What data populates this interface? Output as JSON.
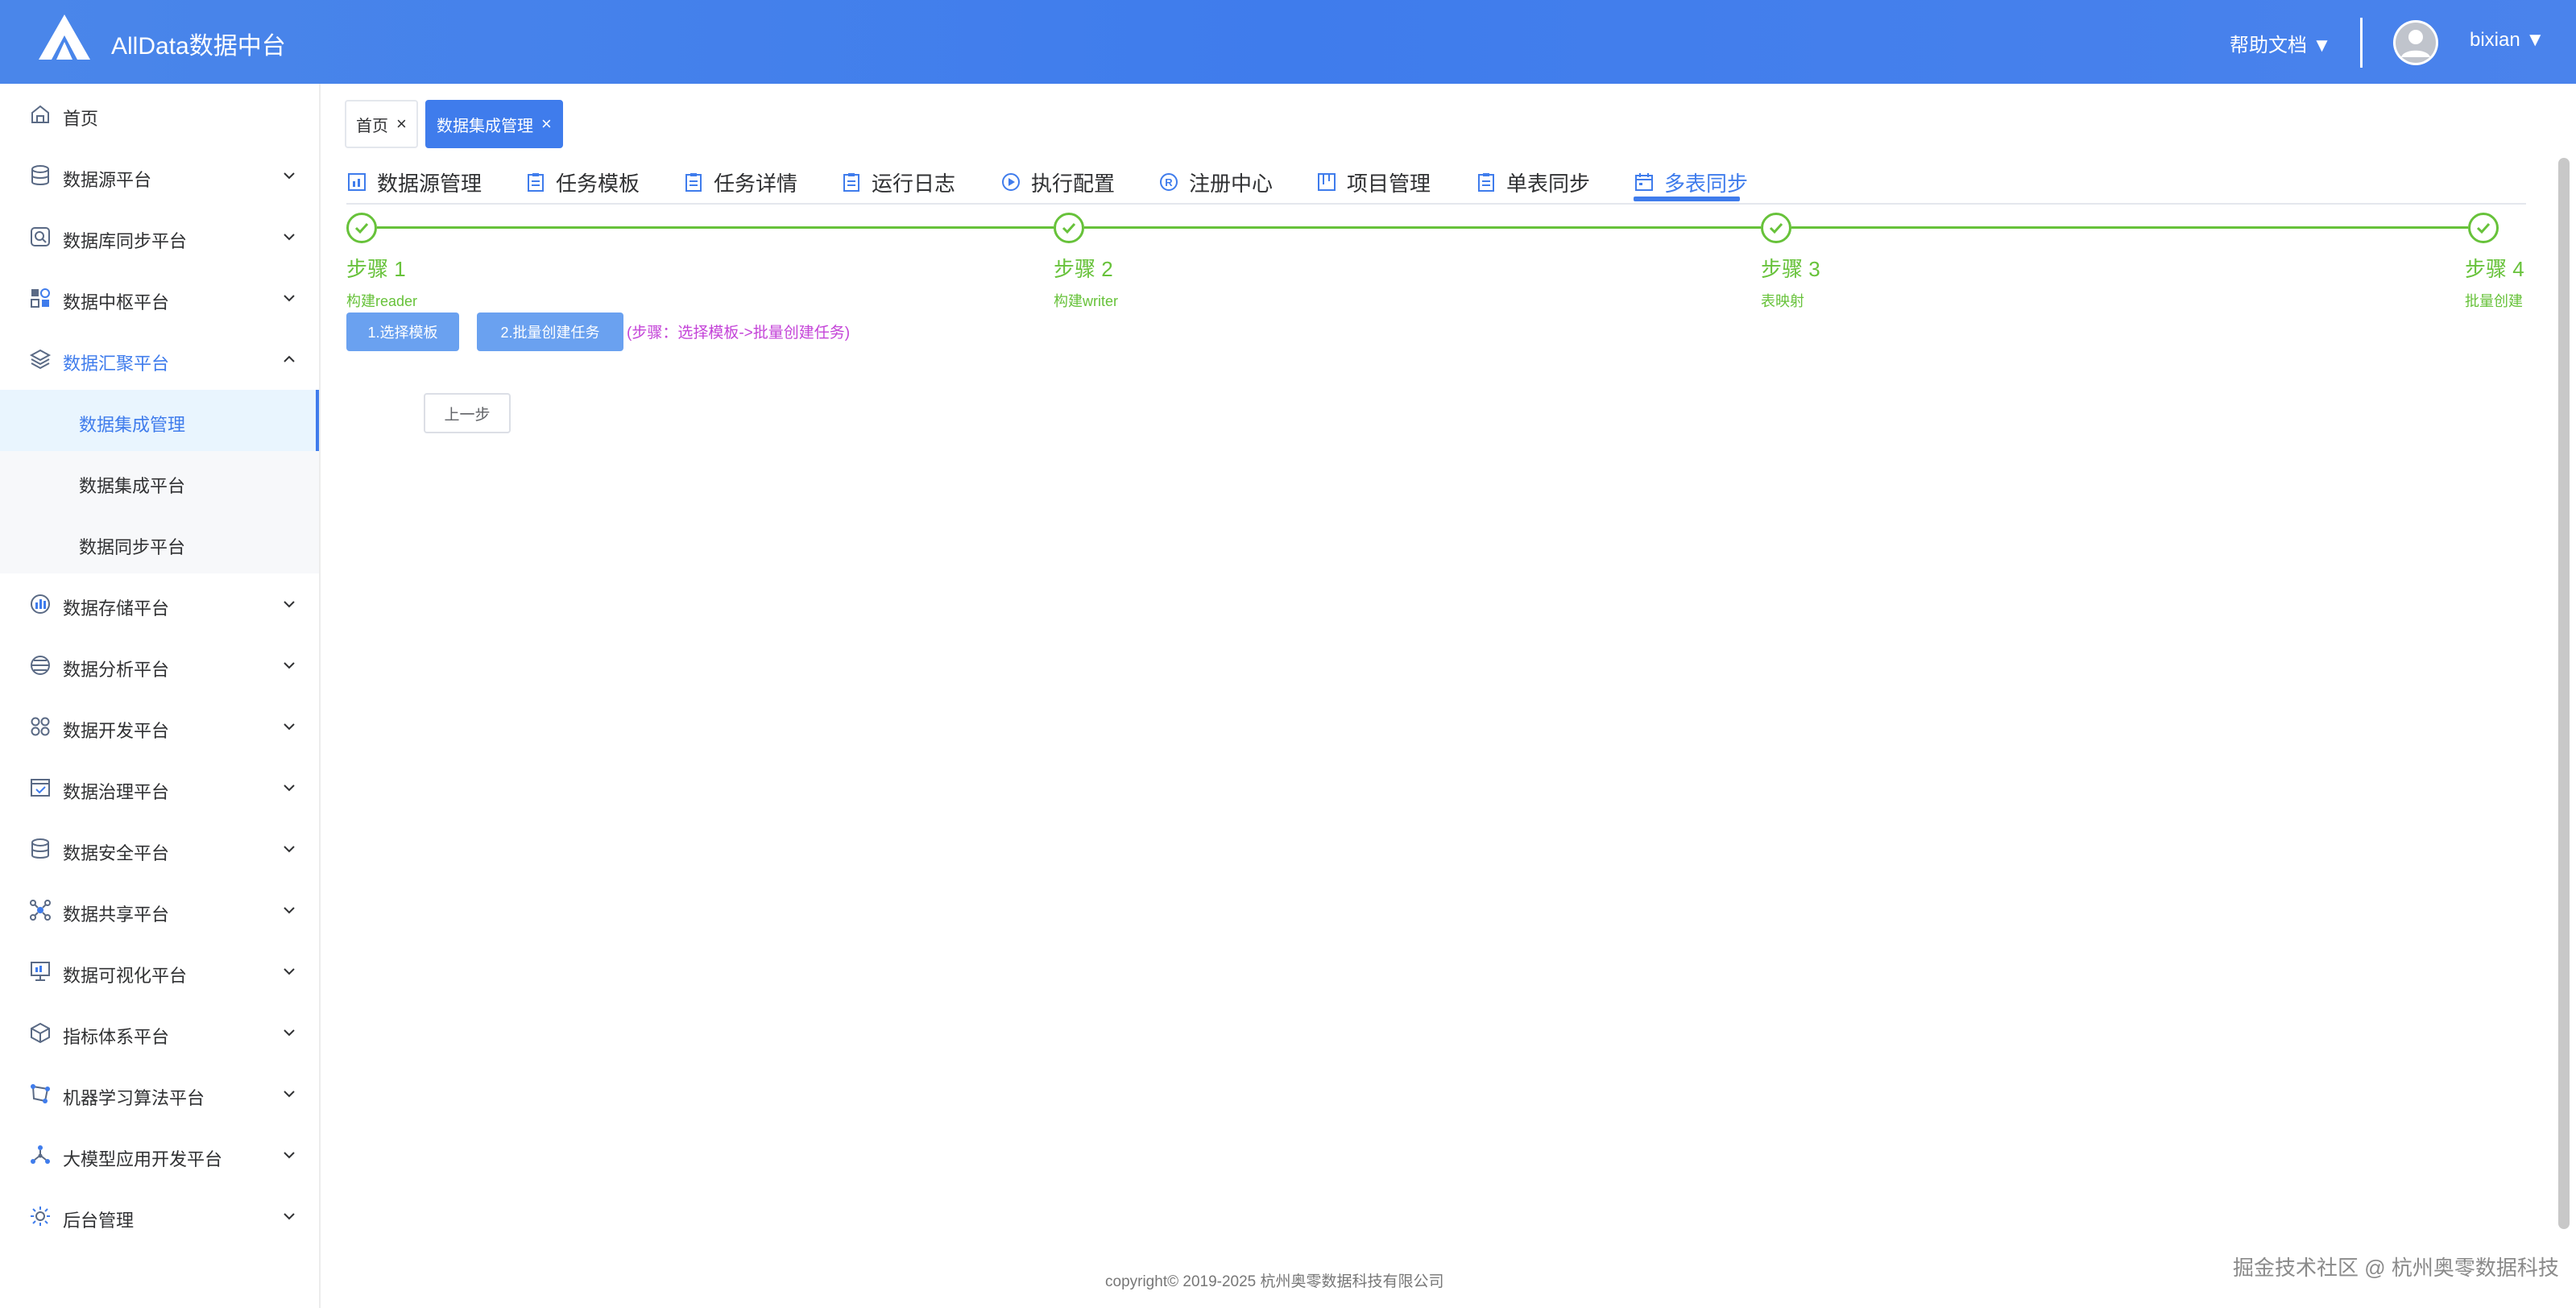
{
  "header": {
    "app_title": "AllData数据中台",
    "help_label": "帮助文档 ▼",
    "user_name": "bixian ▼"
  },
  "sidebar": {
    "items": [
      {
        "label": "首页",
        "icon": "home-icon"
      },
      {
        "label": "数据源平台",
        "icon": "database-icon"
      },
      {
        "label": "数据库同步平台",
        "icon": "db-sync-icon"
      },
      {
        "label": "数据中枢平台",
        "icon": "hub-icon"
      },
      {
        "label": "数据汇聚平台",
        "icon": "layers-icon"
      },
      {
        "label": "数据存储平台",
        "icon": "storage-icon"
      },
      {
        "label": "数据分析平台",
        "icon": "analysis-icon"
      },
      {
        "label": "数据开发平台",
        "icon": "dev-icon"
      },
      {
        "label": "数据治理平台",
        "icon": "governance-icon"
      },
      {
        "label": "数据安全平台",
        "icon": "security-icon"
      },
      {
        "label": "数据共享平台",
        "icon": "share-icon"
      },
      {
        "label": "数据可视化平台",
        "icon": "visual-icon"
      },
      {
        "label": "指标体系平台",
        "icon": "metric-icon"
      },
      {
        "label": "机器学习算法平台",
        "icon": "ml-icon"
      },
      {
        "label": "大模型应用开发平台",
        "icon": "llm-icon"
      },
      {
        "label": "后台管理",
        "icon": "admin-icon"
      }
    ],
    "submenu": [
      {
        "label": "数据集成管理"
      },
      {
        "label": "数据集成平台"
      },
      {
        "label": "数据同步平台"
      }
    ]
  },
  "tags": [
    {
      "label": "首页",
      "close": "×"
    },
    {
      "label": "数据集成管理",
      "close": "×"
    }
  ],
  "tabs": [
    {
      "label": "数据源管理"
    },
    {
      "label": "任务模板"
    },
    {
      "label": "任务详情"
    },
    {
      "label": "运行日志"
    },
    {
      "label": "执行配置"
    },
    {
      "label": "注册中心"
    },
    {
      "label": "项目管理"
    },
    {
      "label": "单表同步"
    },
    {
      "label": "多表同步"
    }
  ],
  "steps": [
    {
      "title": "步骤 1",
      "desc": "构建reader"
    },
    {
      "title": "步骤 2",
      "desc": "构建writer"
    },
    {
      "title": "步骤 3",
      "desc": "表映射"
    },
    {
      "title": "步骤 4",
      "desc": "批量创建"
    }
  ],
  "actions": {
    "select_template": "1.选择模板",
    "batch_create": "2.批量创建任务",
    "hint": "(步骤：选择模板->批量创建任务)",
    "prev_step": "上一步"
  },
  "footer": {
    "copyright": "copyright© 2019-2025 杭州奥零数据科技有限公司",
    "watermark": "掘金技术社区 @ 杭州奥零数据科技"
  },
  "colors": {
    "primary": "#3f7cec",
    "success": "#67c23a",
    "hint": "#c444d8"
  }
}
